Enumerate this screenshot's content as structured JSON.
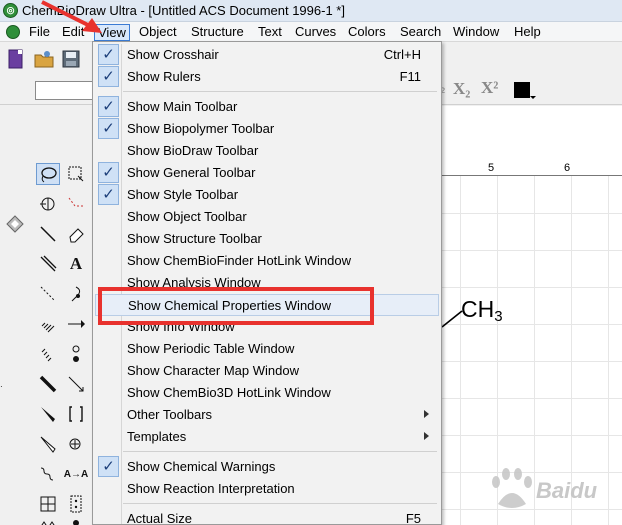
{
  "window": {
    "title": "ChemBioDraw Ultra - [Untitled ACS Document 1996-1 *]"
  },
  "menubar": {
    "items": [
      {
        "label": "File"
      },
      {
        "label": "Edit"
      },
      {
        "label": "View"
      },
      {
        "label": "Object"
      },
      {
        "label": "Structure"
      },
      {
        "label": "Text"
      },
      {
        "label": "Curves"
      },
      {
        "label": "Colors"
      },
      {
        "label": "Search"
      },
      {
        "label": "Window"
      },
      {
        "label": "Help"
      }
    ]
  },
  "style_toolbar": {
    "subscript": "X₂",
    "superscript": "X²"
  },
  "ruler": {
    "ticks": [
      "5",
      "6"
    ]
  },
  "canvas": {
    "molecule_label": "CH",
    "molecule_sub": "3"
  },
  "view_menu": {
    "items": [
      {
        "label": "Show Crosshair",
        "shortcut": "Ctrl+H",
        "checked": true
      },
      {
        "label": "Show Rulers",
        "shortcut": "F11",
        "checked": true
      },
      {
        "label": "Show Main Toolbar",
        "checked": true
      },
      {
        "label": "Show Biopolymer Toolbar",
        "checked": true
      },
      {
        "label": "Show BioDraw Toolbar",
        "checked": false
      },
      {
        "label": "Show General Toolbar",
        "checked": true
      },
      {
        "label": "Show Style Toolbar",
        "checked": true
      },
      {
        "label": "Show Object Toolbar",
        "checked": false
      },
      {
        "label": "Show Structure Toolbar",
        "checked": false
      },
      {
        "label": "Show ChemBioFinder HotLink Window",
        "checked": false
      },
      {
        "label": "Show Analysis Window",
        "checked": false
      },
      {
        "label": "Show Chemical Properties Window",
        "checked": false,
        "highlighted": true
      },
      {
        "label": "Show Info Window",
        "checked": false
      },
      {
        "label": "Show Periodic Table Window",
        "checked": false
      },
      {
        "label": "Show Character Map Window",
        "checked": false
      },
      {
        "label": "Show ChemBio3D HotLink Window",
        "checked": false
      },
      {
        "label": "Other Toolbars",
        "submenu": true
      },
      {
        "label": "Templates",
        "submenu": true
      },
      {
        "label": "Show Chemical Warnings",
        "checked": true
      },
      {
        "label": "Show Reaction Interpretation",
        "checked": false
      },
      {
        "label": "Actual Size",
        "shortcut": "F5"
      }
    ]
  },
  "watermark": {
    "text": "Baidu"
  },
  "colors": {
    "accent": "#3b7bd4",
    "annotation": "#e8322e"
  }
}
